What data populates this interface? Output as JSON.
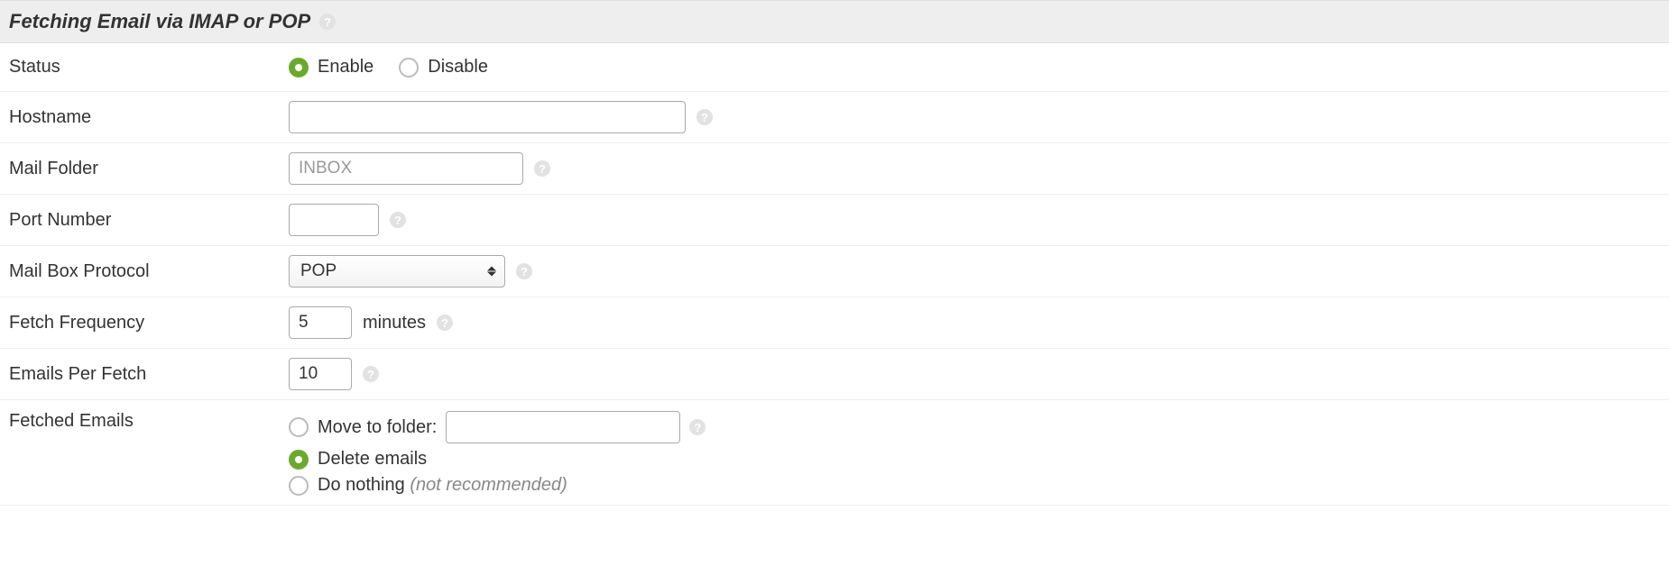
{
  "section": {
    "title": "Fetching Email via IMAP or POP"
  },
  "labels": {
    "status": "Status",
    "hostname": "Hostname",
    "mail_folder": "Mail Folder",
    "port_number": "Port Number",
    "protocol": "Mail Box Protocol",
    "fetch_frequency": "Fetch Frequency",
    "emails_per_fetch": "Emails Per Fetch",
    "fetched_emails": "Fetched Emails"
  },
  "status": {
    "enable": "Enable",
    "disable": "Disable",
    "selected": "enable"
  },
  "hostname": {
    "value": ""
  },
  "mail_folder": {
    "placeholder": "INBOX",
    "value": ""
  },
  "port_number": {
    "value": ""
  },
  "protocol": {
    "selected": "POP"
  },
  "fetch_frequency": {
    "value": "5",
    "unit": "minutes"
  },
  "emails_per_fetch": {
    "value": "10"
  },
  "fetched_emails": {
    "selected": "delete",
    "options": {
      "move": "Move to folder:",
      "delete": "Delete emails",
      "nothing": "Do nothing",
      "nothing_hint": "(not recommended)"
    },
    "move_folder_value": ""
  },
  "icons": {
    "help": "?"
  }
}
